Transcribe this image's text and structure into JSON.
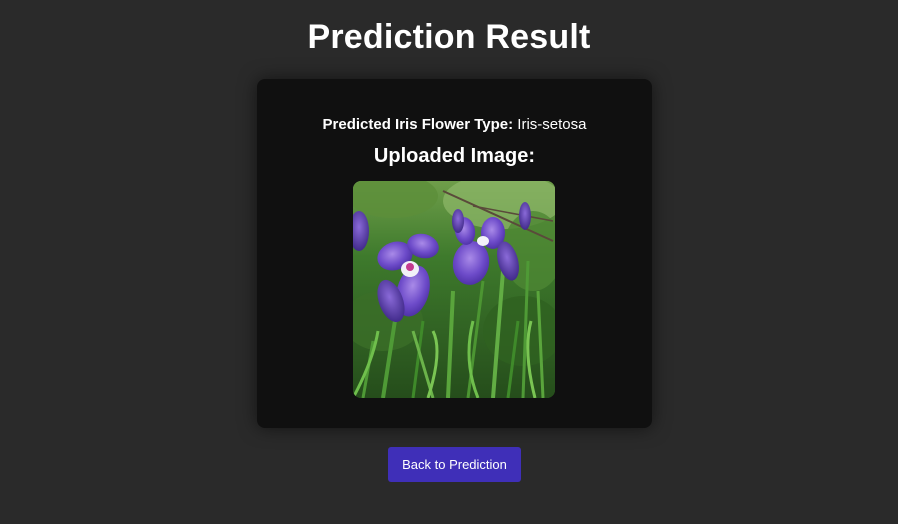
{
  "page": {
    "title": "Prediction Result"
  },
  "result": {
    "prediction_label": "Predicted Iris Flower Type:",
    "prediction_value": "Iris-setosa",
    "image_heading": "Uploaded Image:"
  },
  "actions": {
    "back_label": "Back to Prediction"
  },
  "colors": {
    "background": "#2a2a2a",
    "card": "#101010",
    "button": "#3f2fb8"
  }
}
